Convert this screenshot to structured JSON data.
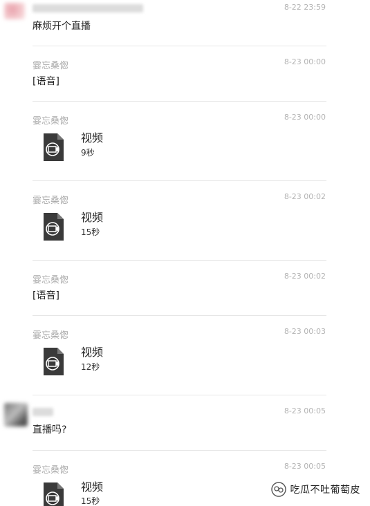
{
  "messages": [
    {
      "sender": "",
      "time": "8-22 23:59",
      "text": "麻烦开个直播"
    },
    {
      "sender": "霎忘桑偬",
      "time": "8-23 00:00",
      "text": "[语音]"
    },
    {
      "sender": "霎忘桑偬",
      "time": "8-23 00:00",
      "video_title": "视频",
      "video_duration": "9秒"
    },
    {
      "sender": "霎忘桑偬",
      "time": "8-23 00:02",
      "video_title": "视频",
      "video_duration": "15秒"
    },
    {
      "sender": "霎忘桑偬",
      "time": "8-23 00:02",
      "text": "[语音]"
    },
    {
      "sender": "霎忘桑偬",
      "time": "8-23 00:03",
      "video_title": "视频",
      "video_duration": "12秒"
    },
    {
      "sender": "",
      "time": "8-23 00:05",
      "text": "直播吗?"
    },
    {
      "sender": "霎忘桑偬",
      "time": "8-23 00:05",
      "video_title": "视频",
      "video_duration": "15秒"
    }
  ],
  "watermark": {
    "text": "吃瓜不吐葡萄皮",
    "icon": "wechat-official-account-icon"
  },
  "icons": {
    "video_file": "video-file-icon"
  }
}
